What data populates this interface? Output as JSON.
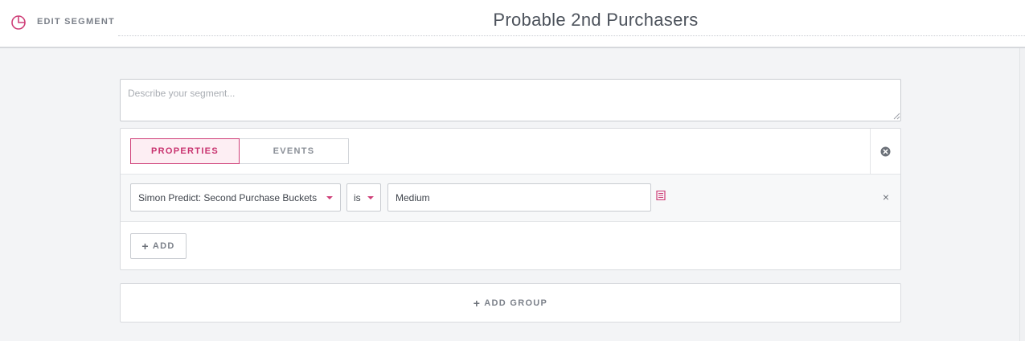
{
  "header": {
    "edit_label": "EDIT SEGMENT",
    "segment_title": "Probable 2nd Purchasers",
    "icon": "pie-chart-icon"
  },
  "description": {
    "placeholder": "Describe your segment...",
    "value": ""
  },
  "group": {
    "tabs": [
      {
        "label": "PROPERTIES",
        "active": true
      },
      {
        "label": "EVENTS",
        "active": false
      }
    ],
    "condition": {
      "property": "Simon Predict: Second Purchase Buckets",
      "operator": "is",
      "value": "Medium"
    },
    "add_label": "ADD"
  },
  "add_group_label": "ADD GROUP",
  "colors": {
    "accent": "#cf3f78",
    "accent_bg": "#fdeef3",
    "page_bg": "#f3f4f6"
  }
}
